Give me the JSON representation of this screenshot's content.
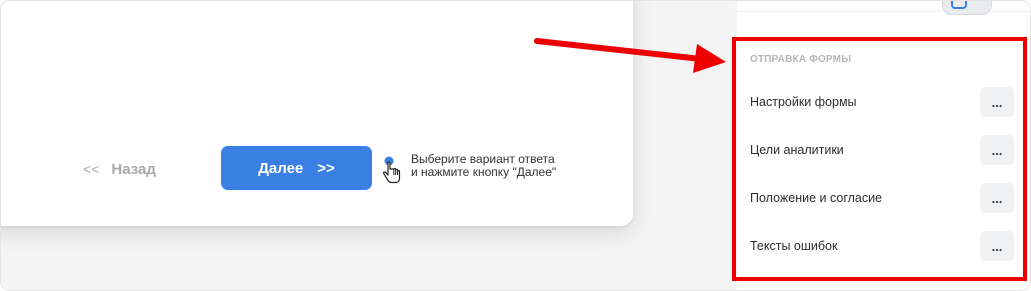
{
  "form_preview": {
    "back_label": "Назад",
    "back_chevron": "<<",
    "next_label": "Далее",
    "next_chevron": ">>",
    "hint_line1": "Выберите вариант ответа",
    "hint_line2": "и нажмите кнопку \"Далее\"",
    "hint_icon": "hand-pointer-icon",
    "accent_color": "#3a7fe3"
  },
  "annotation": {
    "arrow_color": "#ee0000",
    "highlight_color": "#ee0000"
  },
  "sidebar": {
    "section_title": "ОТПРАВКА ФОРМЫ",
    "items": [
      {
        "label": "Настройки формы",
        "action": "..."
      },
      {
        "label": "Цели аналитики",
        "action": "..."
      },
      {
        "label": "Положение и согласие",
        "action": "..."
      },
      {
        "label": "Тексты ошибок",
        "action": "..."
      }
    ]
  }
}
